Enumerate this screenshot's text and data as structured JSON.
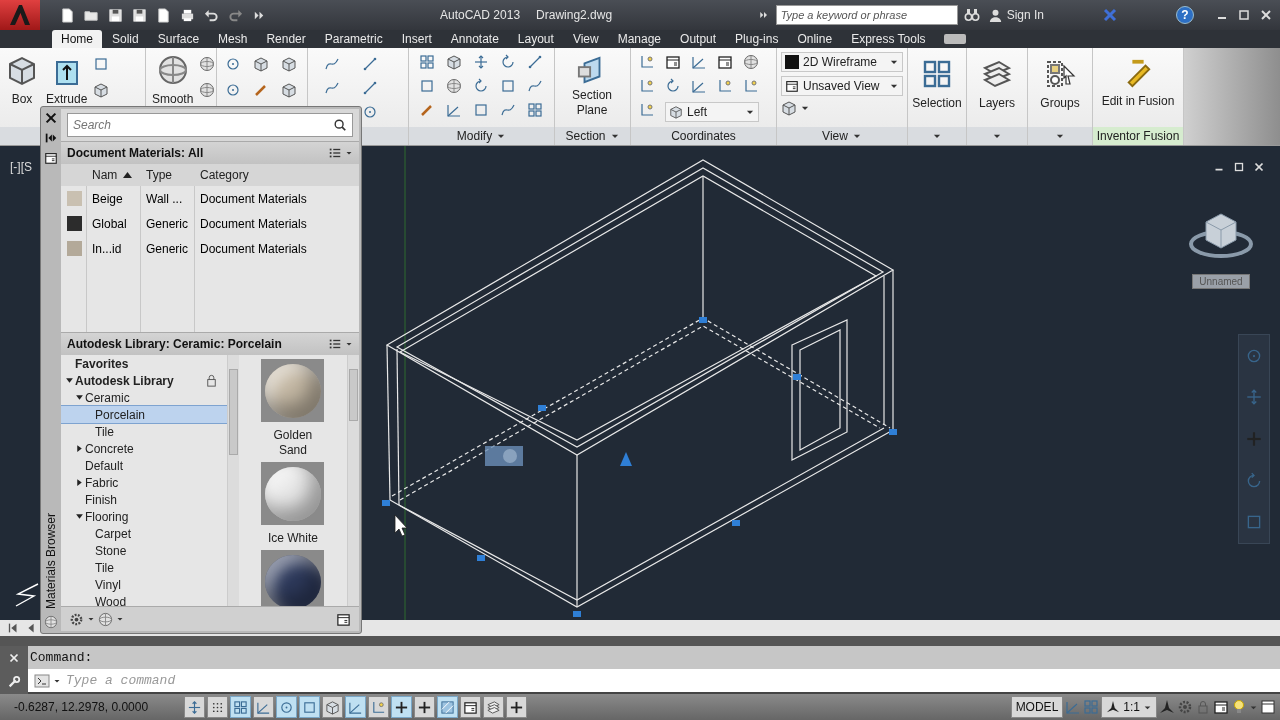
{
  "title_bar": {
    "app": "AutoCAD 2013",
    "file": "Drawing2.dwg",
    "search_placeholder": "Type a keyword or phrase",
    "sign_in": "Sign In",
    "help": "?"
  },
  "tabs": [
    {
      "label": "Home",
      "selected": true
    },
    {
      "label": "Solid",
      "selected": false
    },
    {
      "label": "Surface",
      "selected": false
    },
    {
      "label": "Mesh",
      "selected": false
    },
    {
      "label": "Render",
      "selected": false
    },
    {
      "label": "Parametric",
      "selected": false
    },
    {
      "label": "Insert",
      "selected": false
    },
    {
      "label": "Annotate",
      "selected": false
    },
    {
      "label": "Layout",
      "selected": false
    },
    {
      "label": "View",
      "selected": false
    },
    {
      "label": "Manage",
      "selected": false
    },
    {
      "label": "Output",
      "selected": false
    },
    {
      "label": "Plug-ins",
      "selected": false
    },
    {
      "label": "Online",
      "selected": false
    },
    {
      "label": "Express Tools",
      "selected": false
    }
  ],
  "ribbon": {
    "large_buttons": [
      "Box",
      "Extrude",
      "Smooth",
      "Section Plane",
      "Selection",
      "Layers",
      "Groups",
      "Edit in Fusion"
    ],
    "panel_titles": [
      "Modify",
      "Section",
      "Coordinates",
      "View",
      "Inventor Fusion"
    ],
    "dropdowns": [
      "2D Wireframe",
      "Unsaved View",
      "Left"
    ]
  },
  "viewport": {
    "label": "[-][S",
    "viewcube_button": "Unnamed"
  },
  "materials_browser": {
    "title": "Materials Browser",
    "search_placeholder": "Search",
    "document_materials": {
      "title": "Document Materials: All",
      "columns": [
        {
          "label": "Nam",
          "sorted": true
        },
        {
          "label": "Type",
          "sorted": false
        },
        {
          "label": "Category",
          "sorted": false
        }
      ],
      "rows": [
        {
          "color": "#c9c0b1",
          "name": "Beige",
          "type": "Wall ...",
          "category": "Document Materials"
        },
        {
          "color": "#2c2c2c",
          "name": "Global",
          "type": "Generic",
          "category": "Document Materials"
        },
        {
          "color": "#b3a999",
          "name": "In...id",
          "type": "Generic",
          "category": "Document Materials"
        }
      ]
    },
    "library": {
      "title": "Autodesk Library: Ceramic: Porcelain",
      "tree": [
        {
          "label": "Favorites",
          "selected": false
        },
        {
          "label": "Autodesk Library",
          "selected": false,
          "expanded": true,
          "locked": true,
          "children": [
            {
              "label": "Ceramic",
              "selected": false,
              "expanded": true,
              "children": [
                {
                  "label": "Porcelain",
                  "selected": true
                },
                {
                  "label": "Tile",
                  "selected": false
                }
              ]
            },
            {
              "label": "Concrete",
              "selected": false,
              "expanded": false
            },
            {
              "label": "Default",
              "selected": false
            },
            {
              "label": "Fabric",
              "selected": false,
              "expanded": false
            },
            {
              "label": "Finish",
              "selected": false
            },
            {
              "label": "Flooring",
              "selected": false,
              "expanded": true,
              "children": [
                {
                  "label": "Carpet",
                  "selected": false
                },
                {
                  "label": "Stone",
                  "selected": false
                },
                {
                  "label": "Tile",
                  "selected": false
                },
                {
                  "label": "Vinyl",
                  "selected": false
                },
                {
                  "label": "Wood",
                  "selected": false
                }
              ]
            }
          ]
        }
      ],
      "thumbnails": [
        {
          "label": "Golden Sand",
          "color": "#c4b8a4"
        },
        {
          "label": "Ice White",
          "color": "#e8e8e8"
        },
        {
          "color": "#2e3a5c"
        }
      ]
    }
  },
  "command_line": {
    "history": "Command:",
    "placeholder": "Type a command"
  },
  "status_bar": {
    "coordinates": "-0.6287, 12.2978, 0.0000",
    "toggles": [
      {
        "on": false
      },
      {
        "on": false
      },
      {
        "on": true
      },
      {
        "on": false
      },
      {
        "on": true
      },
      {
        "on": true
      },
      {
        "on": false
      },
      {
        "on": true
      },
      {
        "on": false
      },
      {
        "on": true
      },
      {
        "on": false
      },
      {
        "on": true
      },
      {
        "on": false
      },
      {
        "on": false
      },
      {
        "on": false
      }
    ],
    "model": "MODEL",
    "annotation_scale": "1:1"
  }
}
